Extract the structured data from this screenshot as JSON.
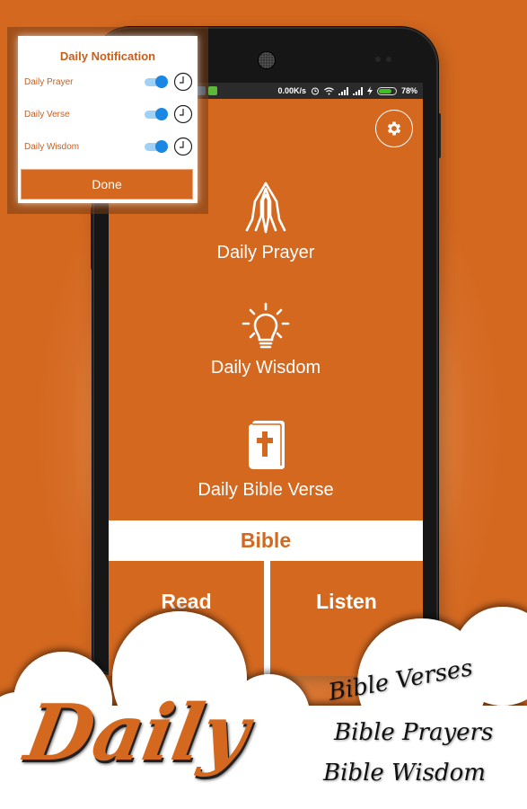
{
  "status_bar": {
    "network_speed": "0.00K/s",
    "battery_percent": "78%",
    "battery_level": 0.78,
    "icons": [
      "notification-app-icon",
      "android-icon",
      "alarm-icon",
      "wifi-icon",
      "signal-icon",
      "signal-icon",
      "charging-icon",
      "battery-icon"
    ]
  },
  "main": {
    "settings_icon": "gear-icon",
    "menu": [
      {
        "label": "Daily Prayer",
        "icon": "praying-hands-icon"
      },
      {
        "label": "Daily Wisdom",
        "icon": "lightbulb-icon"
      },
      {
        "label": "Daily Bible Verse",
        "icon": "bible-icon"
      }
    ],
    "bible_header": "Bible",
    "read_label": "Read",
    "listen_label": "Listen"
  },
  "dialog": {
    "title": "Daily Notification",
    "rows": [
      {
        "label": "Daily Prayer",
        "enabled": true
      },
      {
        "label": "Daily Verse",
        "enabled": true
      },
      {
        "label": "Daily Wisdom",
        "enabled": true
      }
    ],
    "done_label": "Done"
  },
  "promo": {
    "headline": "Daily",
    "taglines": [
      "Bible Verses",
      "Bible Prayers",
      "Bible Wisdom"
    ]
  },
  "colors": {
    "brand_orange": "#d4681f",
    "toggle_on": "#1a87e3",
    "battery_green": "#3ec21f"
  }
}
